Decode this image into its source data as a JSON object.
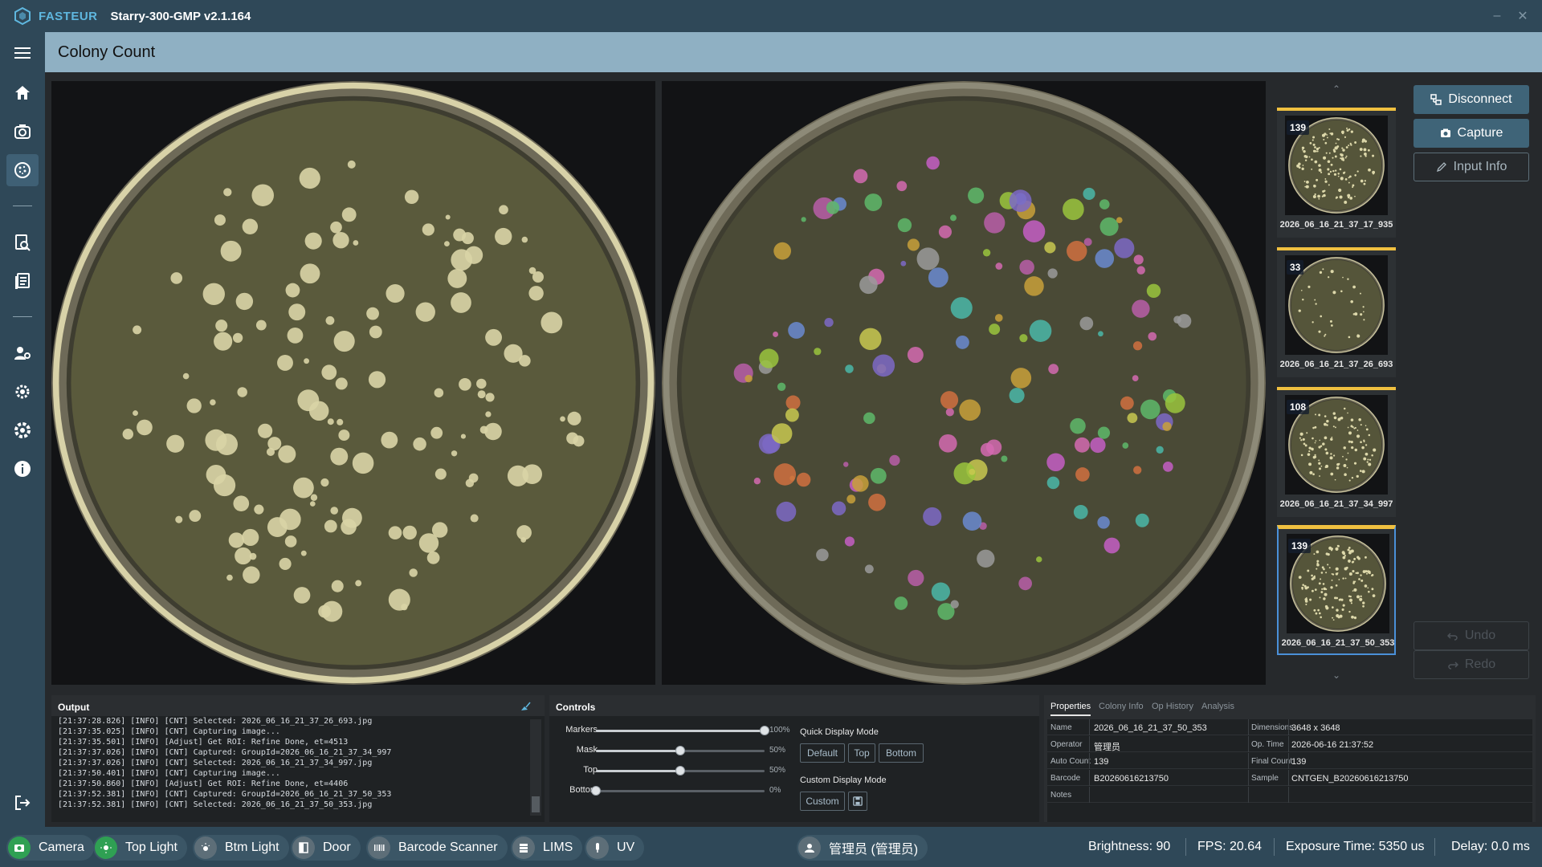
{
  "app": {
    "brand": "FASTEUR",
    "title": "Starry-300-GMP v2.1.164",
    "minimize_glyph": "–",
    "close_glyph": "✕"
  },
  "sidebar": {
    "items": [
      {
        "icon": "menu-icon"
      },
      {
        "icon": "home-icon"
      },
      {
        "icon": "camera-icon"
      },
      {
        "icon": "colony-count-icon",
        "active": true
      },
      {
        "icon": "search-report-icon"
      },
      {
        "icon": "records-icon"
      },
      {
        "icon": "user-management-icon"
      },
      {
        "icon": "device-settings-icon"
      },
      {
        "icon": "settings-icon"
      },
      {
        "icon": "info-icon"
      },
      {
        "icon": "logout-icon"
      }
    ]
  },
  "page": {
    "title": "Colony Count"
  },
  "thumbnails": [
    {
      "count": "139",
      "name": "2026_06_16_21_37_17_935"
    },
    {
      "count": "33",
      "name": "2026_06_16_21_37_26_693"
    },
    {
      "count": "108",
      "name": "2026_06_16_21_37_34_997"
    },
    {
      "count": "139",
      "name": "2026_06_16_21_37_50_353",
      "selected": true
    }
  ],
  "actions": {
    "disconnect": "Disconnect",
    "capture": "Capture",
    "input_info": "Input Info",
    "undo": "Undo",
    "redo": "Redo"
  },
  "output": {
    "title": "Output",
    "lines": [
      "[21:37:28.826] [INFO] [CNT] Selected: 2026_06_16_21_37_26_693.jpg",
      "[21:37:35.025] [INFO] [CNT] Capturing image...",
      "[21:37:35.501] [INFO] [Adjust] Get ROI: Refine Done, et=4513",
      "[21:37:37.026] [INFO] [CNT] Captured: GroupId=2026_06_16_21_37_34_997",
      "[21:37:37.026] [INFO] [CNT] Selected: 2026_06_16_21_37_34_997.jpg",
      "[21:37:50.401] [INFO] [CNT] Capturing image...",
      "[21:37:50.860] [INFO] [Adjust] Get ROI: Refine Done, et=4406",
      "[21:37:52.381] [INFO] [CNT] Captured: GroupId=2026_06_16_21_37_50_353",
      "[21:37:52.381] [INFO] [CNT] Selected: 2026_06_16_21_37_50_353.jpg"
    ]
  },
  "controls": {
    "title": "Controls",
    "sliders": [
      {
        "label": "Markers",
        "value": 100,
        "display": "100%"
      },
      {
        "label": "Mask",
        "value": 50,
        "display": "50%"
      },
      {
        "label": "Top",
        "value": 50,
        "display": "50%"
      },
      {
        "label": "Bottom",
        "value": 0,
        "display": "0%"
      }
    ],
    "quick_mode_title": "Quick Display Mode",
    "quick_modes": [
      "Default",
      "Top",
      "Bottom"
    ],
    "custom_mode_title": "Custom Display Mode",
    "custom_button": "Custom"
  },
  "properties": {
    "tabs": [
      "Properties",
      "Colony Info",
      "Op History",
      "Analysis"
    ],
    "rows": [
      {
        "k1": "Name",
        "v1": "2026_06_16_21_37_50_353",
        "k2": "Dimensions",
        "v2": "3648 x 3648"
      },
      {
        "k1": "Operator",
        "v1": "管理员",
        "k2": "Op. Time",
        "v2": "2026-06-16 21:37:52"
      },
      {
        "k1": "Auto Count",
        "v1": "139",
        "k2": "Final Count",
        "v2": "139"
      },
      {
        "k1": "Barcode",
        "v1": "B20260616213750",
        "k2": "Sample",
        "v2": "CNTGEN_B20260616213750"
      },
      {
        "k1": "Notes",
        "v1": "",
        "k2": "",
        "v2": ""
      }
    ]
  },
  "statusbar": {
    "devices": [
      {
        "label": "Camera",
        "on": true
      },
      {
        "label": "Top Light",
        "on": true
      },
      {
        "label": "Btm Light",
        "on": false
      },
      {
        "label": "Door",
        "on": false
      },
      {
        "label": "Barcode Scanner",
        "on": false
      },
      {
        "label": "LIMS",
        "on": false
      },
      {
        "label": "UV",
        "on": false
      }
    ],
    "user": "管理员 (管理员)",
    "brightness": "Brightness: 90",
    "fps": "FPS: 20.64",
    "exposure": "Exposure Time: 5350 us",
    "delay": "Delay: 0.0 ms"
  },
  "colors": {
    "chrome": "#2f4858",
    "header": "#8fb0c3",
    "accent": "#f0c040",
    "selection": "#4a90d9",
    "status_on": "#2fa053"
  }
}
